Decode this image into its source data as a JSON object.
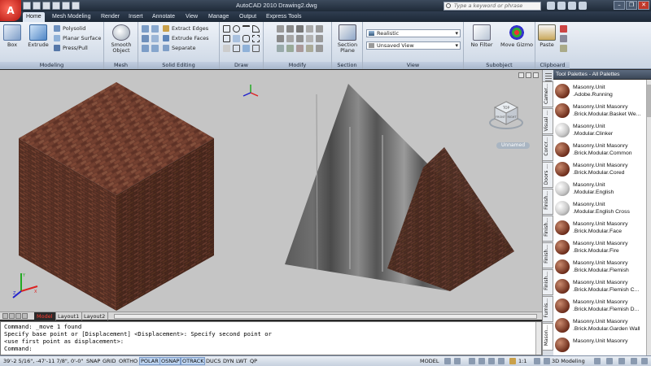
{
  "window": {
    "title": "AutoCAD 2010    Drawing2.dwg",
    "search_placeholder": "Type a keyword or phrase",
    "controls": [
      "–",
      "❐",
      "✕"
    ]
  },
  "ribbon_tabs": [
    "Home",
    "Mesh Modeling",
    "Render",
    "Insert",
    "Annotate",
    "View",
    "Manage",
    "Output",
    "Express Tools"
  ],
  "ribbon": {
    "modeling": {
      "title": "Modeling",
      "box": "Box",
      "extrude": "Extrude",
      "polysolid": "Polysolid",
      "planar_surface": "Planar Surface",
      "press_pull": "Press/Pull"
    },
    "mesh": {
      "title": "Mesh",
      "smooth_object": "Smooth\nObject"
    },
    "solid_editing": {
      "title": "Solid Editing",
      "extract_edges": "Extract Edges",
      "extrude_faces": "Extrude Faces",
      "separate": "Separate"
    },
    "draw": {
      "title": "Draw"
    },
    "modify": {
      "title": "Modify"
    },
    "section": {
      "title": "Section",
      "section_plane": "Section\nPlane"
    },
    "view": {
      "title": "View",
      "visual_style": "Realistic",
      "named_view": "Unsaved View"
    },
    "subobject": {
      "title": "Subobject",
      "filter": "No Filter",
      "move_gizmo": "Move Gizmo"
    },
    "clipboard": {
      "title": "Clipboard",
      "paste": "Paste"
    }
  },
  "viewport": {
    "unnamed_label": "Unnamed",
    "viewcube_top": "TOP",
    "viewcube_front": "FRONT",
    "viewcube_right": "RIGHT"
  },
  "layout_tabs": [
    "Model",
    "Layout1",
    "Layout2"
  ],
  "command_lines": [
    "Command: _move 1 found",
    "Specify base point or [Displacement] <Displacement>: Specify second point or",
    "<use first point as displacement>:",
    "Command:"
  ],
  "status": {
    "coordinates": "39'-2 5/16\", -47'-11 7/8\", 0'-0\"",
    "toggles": [
      "SNAP",
      "GRID",
      "ORTHO",
      "POLAR",
      "OSNAP",
      "OTRACK",
      "DUCS",
      "DYN",
      "LWT",
      "QP"
    ],
    "toggles_on": [
      "POLAR",
      "OSNAP",
      "OTRACK"
    ],
    "model": "MODEL",
    "scale": "1:1",
    "workspace": "3D Modeling"
  },
  "tool_palettes": {
    "title": "Tool Palettes - All Palettes",
    "tabs": [
      "Camer...",
      "Visual ...",
      "Concr...",
      "Doors ...",
      "Finish...",
      "Finish...",
      "Finish...",
      "Finish...",
      "Furnis...",
      "Mason..."
    ],
    "items": [
      {
        "line1": "Masonry.Unit",
        "line2": ".Adobe.Running",
        "ball": "b1"
      },
      {
        "line1": "Masonry.Unit Masonry",
        "line2": ".Brick.Modular.Basket We...",
        "ball": "b1"
      },
      {
        "line1": "Masonry.Unit",
        "line2": ".Modular.Clinker",
        "ball": "b2"
      },
      {
        "line1": "Masonry.Unit Masonry",
        "line2": ".Brick.Modular.Common",
        "ball": "b1"
      },
      {
        "line1": "Masonry.Unit Masonry",
        "line2": ".Brick.Modular.Cored",
        "ball": "b1"
      },
      {
        "line1": "Masonry.Unit",
        "line2": ".Modular.English",
        "ball": "b2"
      },
      {
        "line1": "Masonry.Unit",
        "line2": ".Modular.English Cross",
        "ball": "b2"
      },
      {
        "line1": "Masonry.Unit Masonry",
        "line2": ".Brick.Modular.Face",
        "ball": "b1"
      },
      {
        "line1": "Masonry.Unit Masonry",
        "line2": ".Brick.Modular.Fire",
        "ball": "b1"
      },
      {
        "line1": "Masonry.Unit Masonry",
        "line2": ".Brick.Modular.Flemish",
        "ball": "b1"
      },
      {
        "line1": "Masonry.Unit Masonry",
        "line2": ".Brick.Modular.Flemish C...",
        "ball": "b1"
      },
      {
        "line1": "Masonry.Unit Masonry",
        "line2": ".Brick.Modular.Flemish D...",
        "ball": "b1"
      },
      {
        "line1": "Masonry.Unit Masonry",
        "line2": ".Brick.Modular.Garden Wall",
        "ball": "b1"
      },
      {
        "line1": "Masonry.Unit Masonry",
        "line2": "",
        "ball": "b1"
      }
    ]
  }
}
